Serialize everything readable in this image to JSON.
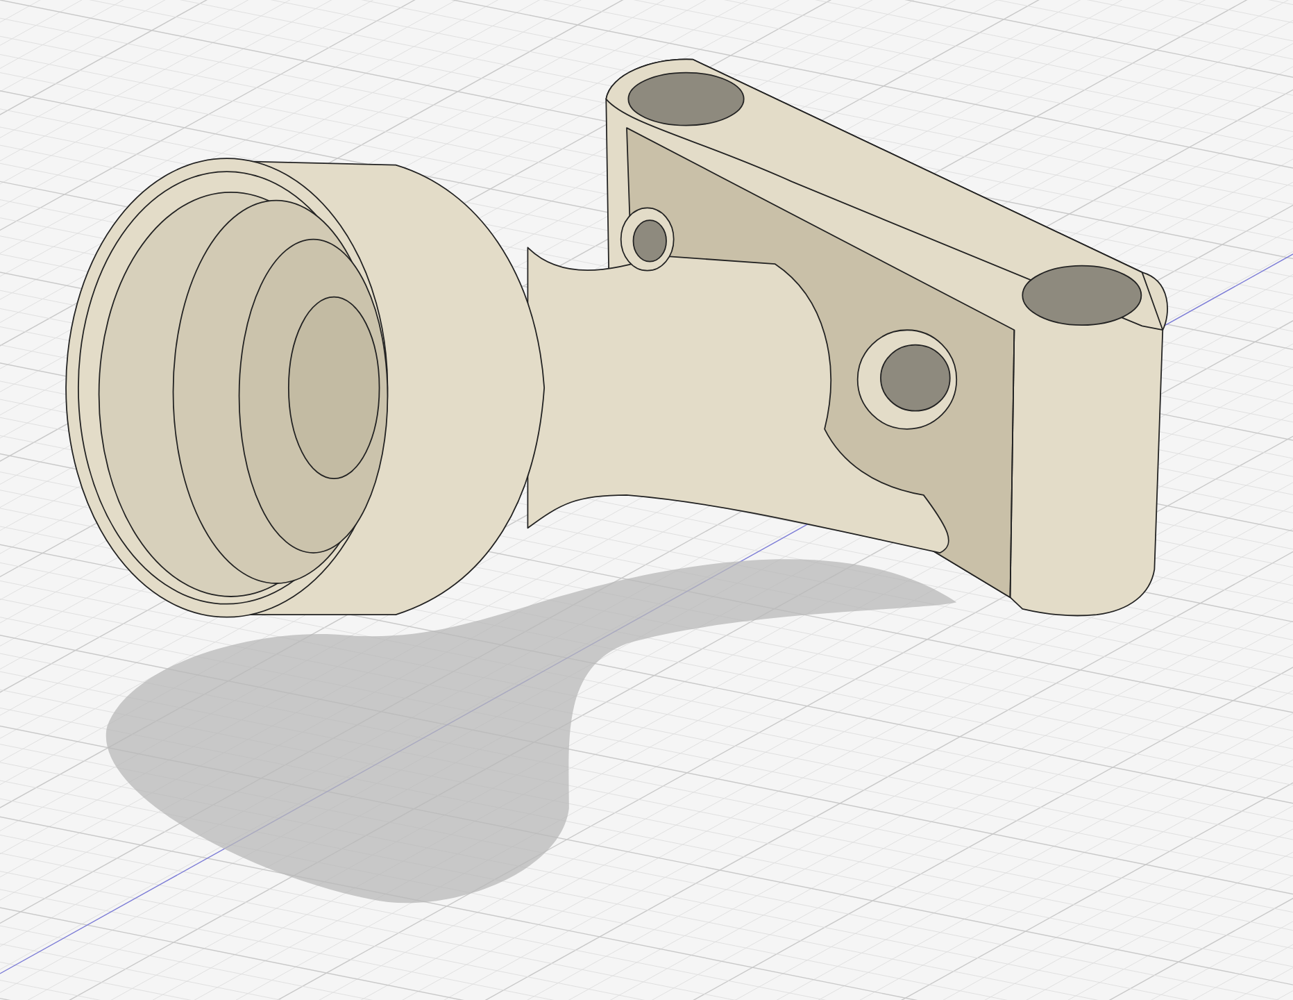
{
  "viewport": {
    "show_grid": true,
    "show_shadow": true
  }
}
